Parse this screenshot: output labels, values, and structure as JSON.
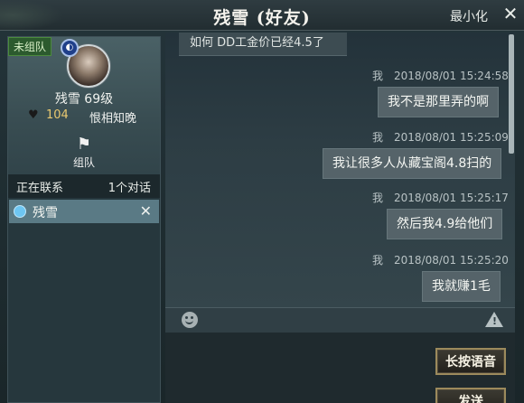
{
  "window": {
    "title": "残雪 (好友)",
    "minimize_label": "最小化",
    "close_label": "✕"
  },
  "profile": {
    "team_status": "未组队",
    "name_level": "残雪  69级",
    "affinity": "104",
    "affinity_title": "恨相知晚",
    "team_button_label": "组队"
  },
  "contacts": {
    "header_left": "正在联系",
    "header_right": "1个对话",
    "items": [
      {
        "name": "残雪"
      }
    ]
  },
  "messages": {
    "partial_top": "如何  DD工金价已经4.5了",
    "items": [
      {
        "sender": "我",
        "time": "2018/08/01  15:24:58",
        "text": "我不是那里弄的啊"
      },
      {
        "sender": "我",
        "time": "2018/08/01  15:25:09",
        "text": "我让很多人从藏宝阁4.8扫的"
      },
      {
        "sender": "我",
        "time": "2018/08/01  15:25:17",
        "text": "然后我4.9给他们"
      },
      {
        "sender": "我",
        "time": "2018/08/01  15:25:20",
        "text": "我就赚1毛"
      }
    ]
  },
  "actions": {
    "voice_label": "长按语音",
    "send_label": "发送"
  }
}
